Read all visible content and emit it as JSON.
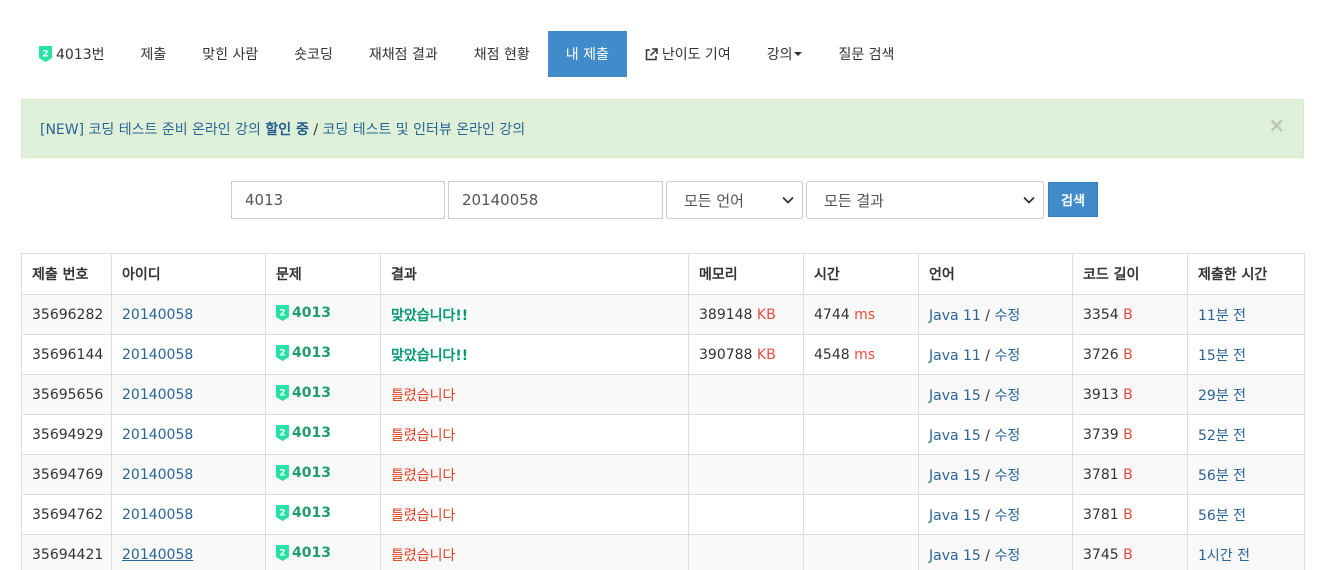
{
  "nav": {
    "problem_label": "4013번",
    "items": [
      {
        "label": "제출",
        "active": false
      },
      {
        "label": "맞힌 사람",
        "active": false
      },
      {
        "label": "숏코딩",
        "active": false
      },
      {
        "label": "재채점 결과",
        "active": false
      },
      {
        "label": "채점 현황",
        "active": false
      },
      {
        "label": "내 제출",
        "active": true
      },
      {
        "label": "난이도 기여",
        "active": false
      },
      {
        "label": "강의",
        "active": false
      },
      {
        "label": "질문 검색",
        "active": false
      }
    ]
  },
  "alert": {
    "part1": "[NEW] 코딩 테스트 준비 온라인 강의 ",
    "bold": "할인 중",
    "sep": " / ",
    "part2": "코딩 테스트 및 인터뷰 온라인 강의",
    "close": "×"
  },
  "search": {
    "problem_value": "4013",
    "user_value": "20140058",
    "language_selected": "모든 언어",
    "result_selected": "모든 결과",
    "button_label": "검색"
  },
  "table": {
    "headers": [
      "제출 번호",
      "아이디",
      "문제",
      "결과",
      "메모리",
      "시간",
      "언어",
      "코드 길이",
      "제출한 시간"
    ],
    "rows": [
      {
        "id": "35696282",
        "user": "20140058",
        "problem": "4013",
        "result": "맞았습니다!!",
        "status": "ac",
        "memory": "389148",
        "memory_unit": "KB",
        "time": "4744",
        "time_unit": "ms",
        "lang": "Java 11",
        "edit": "수정",
        "length": "3354",
        "length_unit": "B",
        "submitted": "11분 전"
      },
      {
        "id": "35696144",
        "user": "20140058",
        "problem": "4013",
        "result": "맞았습니다!!",
        "status": "ac",
        "memory": "390788",
        "memory_unit": "KB",
        "time": "4548",
        "time_unit": "ms",
        "lang": "Java 11",
        "edit": "수정",
        "length": "3726",
        "length_unit": "B",
        "submitted": "15분 전"
      },
      {
        "id": "35695656",
        "user": "20140058",
        "problem": "4013",
        "result": "틀렸습니다",
        "status": "wa",
        "memory": "",
        "memory_unit": "",
        "time": "",
        "time_unit": "",
        "lang": "Java 15",
        "edit": "수정",
        "length": "3913",
        "length_unit": "B",
        "submitted": "29분 전"
      },
      {
        "id": "35694929",
        "user": "20140058",
        "problem": "4013",
        "result": "틀렸습니다",
        "status": "wa",
        "memory": "",
        "memory_unit": "",
        "time": "",
        "time_unit": "",
        "lang": "Java 15",
        "edit": "수정",
        "length": "3739",
        "length_unit": "B",
        "submitted": "52분 전"
      },
      {
        "id": "35694769",
        "user": "20140058",
        "problem": "4013",
        "result": "틀렸습니다",
        "status": "wa",
        "memory": "",
        "memory_unit": "",
        "time": "",
        "time_unit": "",
        "lang": "Java 15",
        "edit": "수정",
        "length": "3781",
        "length_unit": "B",
        "submitted": "56분 전"
      },
      {
        "id": "35694762",
        "user": "20140058",
        "problem": "4013",
        "result": "틀렸습니다",
        "status": "wa",
        "memory": "",
        "memory_unit": "",
        "time": "",
        "time_unit": "",
        "lang": "Java 15",
        "edit": "수정",
        "length": "3781",
        "length_unit": "B",
        "submitted": "56분 전"
      },
      {
        "id": "35694421",
        "user": "20140058",
        "problem": "4013",
        "result": "틀렸습니다",
        "status": "wa",
        "memory": "",
        "memory_unit": "",
        "time": "",
        "time_unit": "",
        "lang": "Java 15",
        "edit": "수정",
        "length": "3745",
        "length_unit": "B",
        "submitted": "1시간 전"
      }
    ]
  },
  "colors": {
    "accent": "#428bca",
    "link": "#2a6496",
    "accepted": "#009874",
    "wrong": "#dd4124",
    "tier": "#27e2a4"
  },
  "icons": {
    "tier": "gold-tier-2-badge-icon",
    "external": "external-link-icon",
    "caret": "caret-down-icon",
    "chevron": "chevron-down-icon"
  }
}
